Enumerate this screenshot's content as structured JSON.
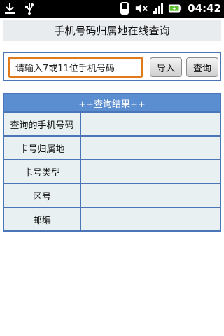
{
  "status_bar": {
    "time": "04:42",
    "icons": [
      "download-icon",
      "usb-icon",
      "wifi-icon",
      "mute-icon",
      "signal-icon",
      "battery-icon"
    ]
  },
  "app": {
    "title": "手机号码归属地在线查询"
  },
  "search": {
    "input_value": "请输入7或11位手机号码",
    "import_label": "导入",
    "query_label": "查询"
  },
  "result": {
    "header": "++查询结果++",
    "rows": [
      {
        "label": "查询的手机号码",
        "value": ""
      },
      {
        "label": "卡号归属地",
        "value": ""
      },
      {
        "label": "卡号类型",
        "value": ""
      },
      {
        "label": "区号",
        "value": ""
      },
      {
        "label": "邮编",
        "value": ""
      }
    ]
  },
  "colors": {
    "accent_border": "#4a76b8",
    "header_bg": "#5b8dd1",
    "input_focus": "#e07a1a",
    "cell_bg": "#e8f0f1"
  }
}
